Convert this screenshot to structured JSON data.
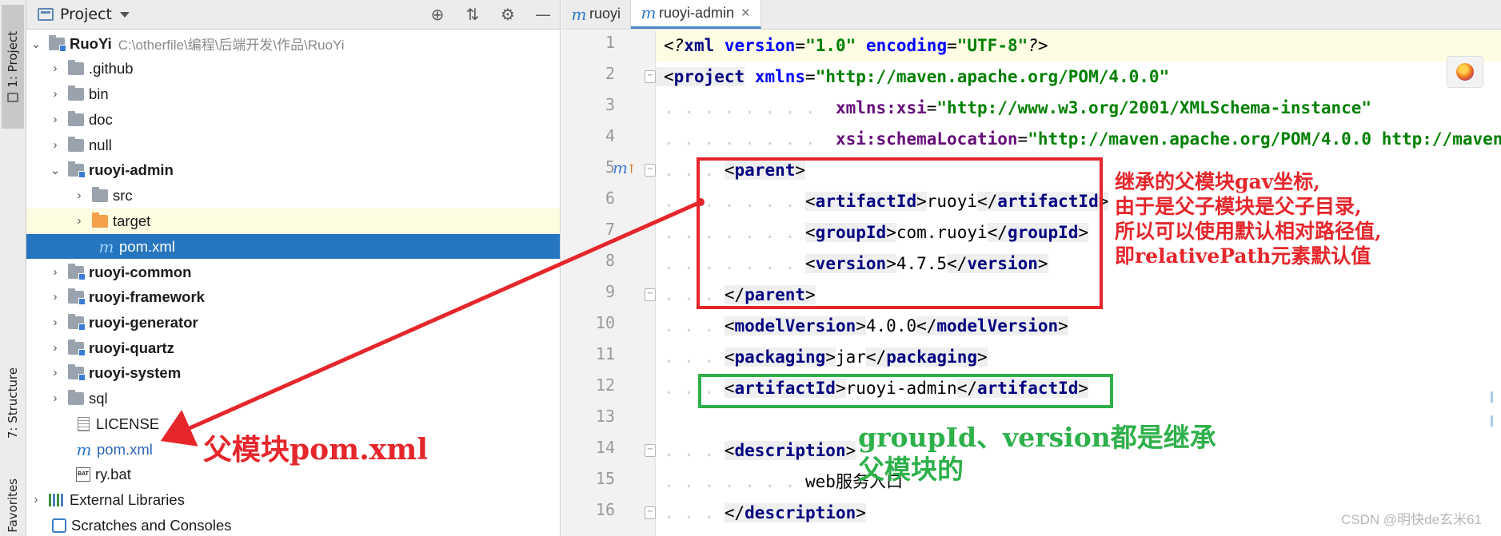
{
  "toolstrip": {
    "project_tab": "1: Project",
    "structure_tab": "7: Structure",
    "favorites_tab": "Favorites"
  },
  "project_panel": {
    "title": "Project",
    "tree": [
      {
        "label": "RuoYi",
        "path": "C:\\otherfile\\编程\\后端开发\\作品\\RuoYi"
      },
      {
        "label": ".github"
      },
      {
        "label": "bin"
      },
      {
        "label": "doc"
      },
      {
        "label": "null"
      },
      {
        "label": "ruoyi-admin"
      },
      {
        "label": "src"
      },
      {
        "label": "target"
      },
      {
        "label": "pom.xml"
      },
      {
        "label": "ruoyi-common"
      },
      {
        "label": "ruoyi-framework"
      },
      {
        "label": "ruoyi-generator"
      },
      {
        "label": "ruoyi-quartz"
      },
      {
        "label": "ruoyi-system"
      },
      {
        "label": "sql"
      },
      {
        "label": "LICENSE"
      },
      {
        "label": "pom.xml"
      },
      {
        "label": "ry.bat"
      },
      {
        "label": "External Libraries"
      },
      {
        "label": "Scratches and Consoles"
      }
    ]
  },
  "editor": {
    "tabs": [
      {
        "label": "ruoyi",
        "active": false
      },
      {
        "label": "ruoyi-admin",
        "active": true
      }
    ],
    "line_numbers": [
      "1",
      "2",
      "3",
      "4",
      "5",
      "6",
      "7",
      "8",
      "9",
      "10",
      "11",
      "12",
      "13",
      "14",
      "15",
      "16"
    ],
    "code": {
      "l1_decl": "<?xml version=\"1.0\" encoding=\"UTF-8\"?>",
      "l1_xml": "xml",
      "l1_version_attr": "version",
      "l1_version_val": "\"1.0\"",
      "l1_encoding_attr": "encoding",
      "l1_encoding_val": "\"UTF-8\"",
      "l2_tag": "project",
      "l2_attr": "xmlns",
      "l2_val": "\"http://maven.apache.org/POM/4.0.0\"",
      "l3_ns": "xmlns:xsi",
      "l3_val": "\"http://www.w3.org/2001/XMLSchema-instance\"",
      "l4_ns": "xsi:schemaLocation",
      "l4_val": "\"http://maven.apache.org/POM/4.0.0 http://maven",
      "parent_tag": "parent",
      "artifactId_tag": "artifactId",
      "artifactId_parent_val": "ruoyi",
      "groupId_tag": "groupId",
      "groupId_val": "com.ruoyi",
      "version_tag": "version",
      "version_val": "4.7.5",
      "modelVersion_tag": "modelVersion",
      "modelVersion_val": "4.0.0",
      "packaging_tag": "packaging",
      "packaging_val": "jar",
      "artifactId_val": "ruoyi-admin",
      "description_tag": "description",
      "description_val": "web服务入口"
    }
  },
  "annotations": {
    "red_note": [
      "继承的父模块gav坐标,",
      "由于是父子模块是父子目录,",
      "所以可以使用默认相对路径值,",
      "即relativePath元素默认值"
    ],
    "green_note": [
      "groupId、version都是继承",
      "父模块的"
    ],
    "parent_pom_note": "父模块pom.xml",
    "red_color": "#e5262b",
    "green_color": "#2eb04a"
  },
  "watermark": "CSDN @明快de玄米61"
}
